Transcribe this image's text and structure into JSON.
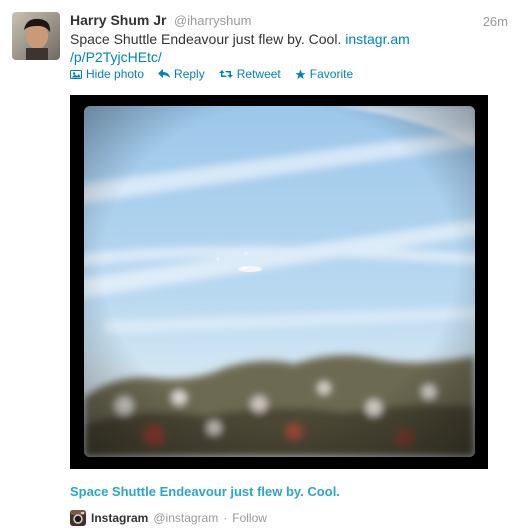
{
  "tweet": {
    "fullname": "Harry Shum Jr",
    "username": "@iharryshum",
    "time": "26m",
    "text_before": "Space Shuttle Endeavour just flew by. Cool. ",
    "link_line1": "instagr.am",
    "link_line2": "/p/P2TyjcHEtc/",
    "actions": {
      "hide_photo": "Hide photo",
      "reply": "Reply",
      "retweet": "Retweet",
      "favorite": "Favorite"
    },
    "media": {
      "caption": "Space Shuttle Endeavour just flew by. Cool.",
      "source_name": "Instagram",
      "source_handle": "@instagram",
      "separator": "·",
      "follow": "Follow"
    }
  },
  "colors": {
    "link": "#0084b4",
    "caption": "#2ba6cb",
    "muted": "#999999",
    "text": "#333333"
  }
}
